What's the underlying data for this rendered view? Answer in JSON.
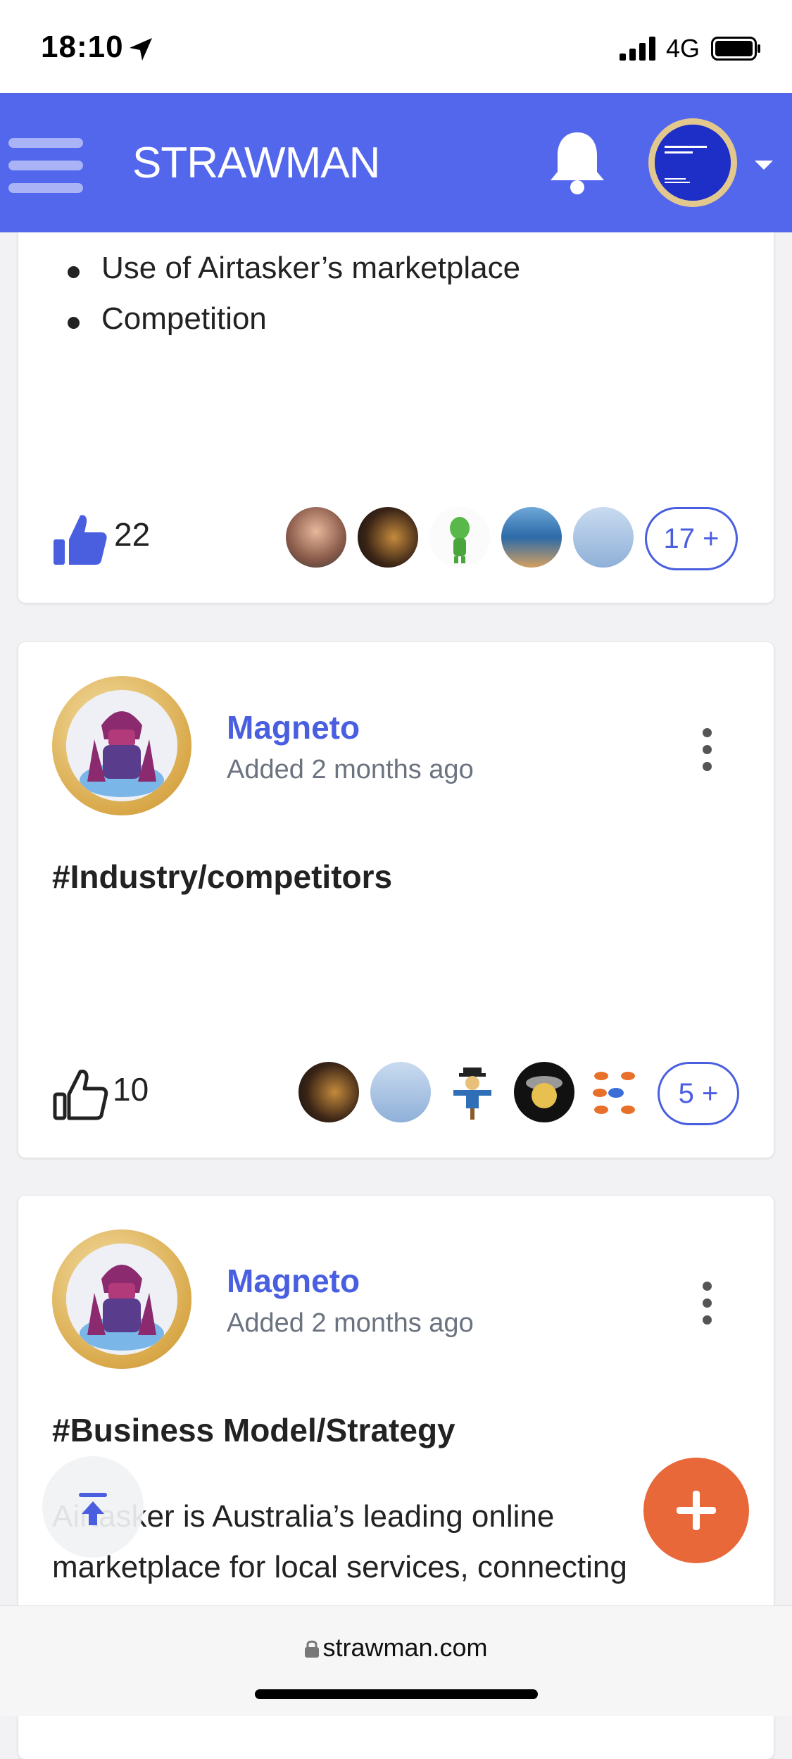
{
  "status_bar": {
    "time": "18:10",
    "network": "4G"
  },
  "header": {
    "logo_text": "STRAWMAN"
  },
  "cards": [
    {
      "bullets": [
        "Use of Airtasker’s marketplace",
        "Competition"
      ],
      "likes": "22",
      "more_likers": "17 +"
    },
    {
      "author": "Magneto",
      "added": "Added 2 months ago",
      "title": "#Industry/competitors",
      "likes": "10",
      "more_likers": "5 +"
    },
    {
      "author": "Magneto",
      "added": "Added 2 months ago",
      "title": "#Business Model/Strategy",
      "body_line1": "Airtasker is Australia’s leading online",
      "body_line2": "marketplace for local services, connecting"
    }
  ],
  "browser": {
    "url": "strawman.com"
  },
  "colors": {
    "brand": "#5367ec",
    "accent_link": "#4a5fe0",
    "fab": "#e8683a"
  }
}
